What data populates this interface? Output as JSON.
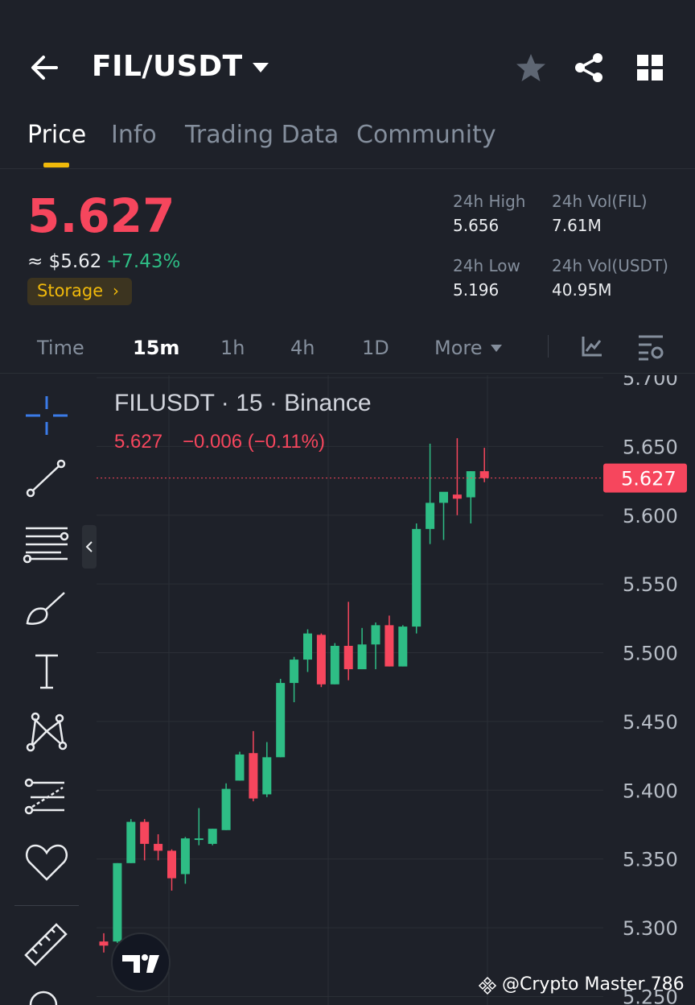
{
  "header": {
    "pair": "FIL/USDT",
    "icons": [
      "back-arrow-icon",
      "chevron-down-icon",
      "star-icon",
      "share-icon",
      "grid-icon"
    ]
  },
  "tabs": [
    {
      "label": "Price",
      "active": true
    },
    {
      "label": "Info",
      "active": false
    },
    {
      "label": "Trading Data",
      "active": false
    },
    {
      "label": "Community",
      "active": false
    }
  ],
  "ticker": {
    "price": "5.627",
    "approx": "≈ $5.62",
    "change": "+7.43%",
    "tag": "Storage",
    "tag_arrow": "›",
    "high_label": "24h High",
    "high": "5.656",
    "low_label": "24h Low",
    "low": "5.196",
    "vol_fil_label": "24h Vol(FIL)",
    "vol_fil": "7.61M",
    "vol_usdt_label": "24h Vol(USDT)",
    "vol_usdt": "40.95M"
  },
  "timeframes": {
    "items": [
      "Time",
      "15m",
      "1h",
      "4h",
      "1D",
      "More"
    ],
    "active": "15m"
  },
  "colors": {
    "up": "#2ebd85",
    "down": "#f6465d",
    "accent": "#f0b90b",
    "background": "#1e2129"
  },
  "tool_icons": [
    "crosshair-icon",
    "trendline-icon",
    "fib-lines-icon",
    "brush-icon",
    "text-icon",
    "pattern-icon",
    "forecast-icon",
    "favorite-heart-icon",
    "ruler-icon",
    "zoom-icon"
  ],
  "chart_data": {
    "type": "candlestick",
    "title": "FILUSDT · 15 · Binance",
    "legend_value": "5.627",
    "legend_change": "−0.006 (−0.11%)",
    "last_price": 5.627,
    "last_price_label": "5.627",
    "yticks": [
      "5.700",
      "5.650",
      "5.600",
      "5.550",
      "5.500",
      "5.450",
      "5.400",
      "5.350",
      "5.300",
      "5.250"
    ],
    "yrange": [
      5.245,
      5.7
    ],
    "candles": [
      {
        "o": 5.29,
        "h": 5.296,
        "l": 5.282,
        "c": 5.287
      },
      {
        "o": 5.29,
        "h": 5.347,
        "l": 5.289,
        "c": 5.347
      },
      {
        "o": 5.347,
        "h": 5.379,
        "l": 5.347,
        "c": 5.377
      },
      {
        "o": 5.377,
        "h": 5.379,
        "l": 5.349,
        "c": 5.361
      },
      {
        "o": 5.361,
        "h": 5.368,
        "l": 5.349,
        "c": 5.356
      },
      {
        "o": 5.356,
        "h": 5.357,
        "l": 5.327,
        "c": 5.336
      },
      {
        "o": 5.339,
        "h": 5.366,
        "l": 5.332,
        "c": 5.365
      },
      {
        "o": 5.364,
        "h": 5.387,
        "l": 5.36,
        "c": 5.365
      },
      {
        "o": 5.361,
        "h": 5.372,
        "l": 5.36,
        "c": 5.372
      },
      {
        "o": 5.371,
        "h": 5.405,
        "l": 5.371,
        "c": 5.401
      },
      {
        "o": 5.407,
        "h": 5.428,
        "l": 5.407,
        "c": 5.426
      },
      {
        "o": 5.427,
        "h": 5.443,
        "l": 5.392,
        "c": 5.394
      },
      {
        "o": 5.397,
        "h": 5.435,
        "l": 5.395,
        "c": 5.424
      },
      {
        "o": 5.424,
        "h": 5.481,
        "l": 5.424,
        "c": 5.478
      },
      {
        "o": 5.478,
        "h": 5.497,
        "l": 5.464,
        "c": 5.495
      },
      {
        "o": 5.495,
        "h": 5.517,
        "l": 5.486,
        "c": 5.514
      },
      {
        "o": 5.513,
        "h": 5.514,
        "l": 5.475,
        "c": 5.477
      },
      {
        "o": 5.477,
        "h": 5.507,
        "l": 5.477,
        "c": 5.505
      },
      {
        "o": 5.505,
        "h": 5.537,
        "l": 5.48,
        "c": 5.488
      },
      {
        "o": 5.488,
        "h": 5.518,
        "l": 5.488,
        "c": 5.506
      },
      {
        "o": 5.506,
        "h": 5.522,
        "l": 5.488,
        "c": 5.52
      },
      {
        "o": 5.52,
        "h": 5.527,
        "l": 5.49,
        "c": 5.49
      },
      {
        "o": 5.49,
        "h": 5.52,
        "l": 5.49,
        "c": 5.519
      },
      {
        "o": 5.519,
        "h": 5.594,
        "l": 5.514,
        "c": 5.59
      },
      {
        "o": 5.59,
        "h": 5.652,
        "l": 5.579,
        "c": 5.609
      },
      {
        "o": 5.609,
        "h": 5.616,
        "l": 5.582,
        "c": 5.617
      },
      {
        "o": 5.615,
        "h": 5.656,
        "l": 5.6,
        "c": 5.612
      },
      {
        "o": 5.613,
        "h": 5.632,
        "l": 5.594,
        "c": 5.632
      },
      {
        "o": 5.632,
        "h": 5.649,
        "l": 5.624,
        "c": 5.627
      }
    ]
  },
  "watermark": {
    "text": "@Crypto Master 786",
    "icon": "binance-logo-icon"
  },
  "branding": {
    "logo": "tradingview-logo-icon"
  }
}
